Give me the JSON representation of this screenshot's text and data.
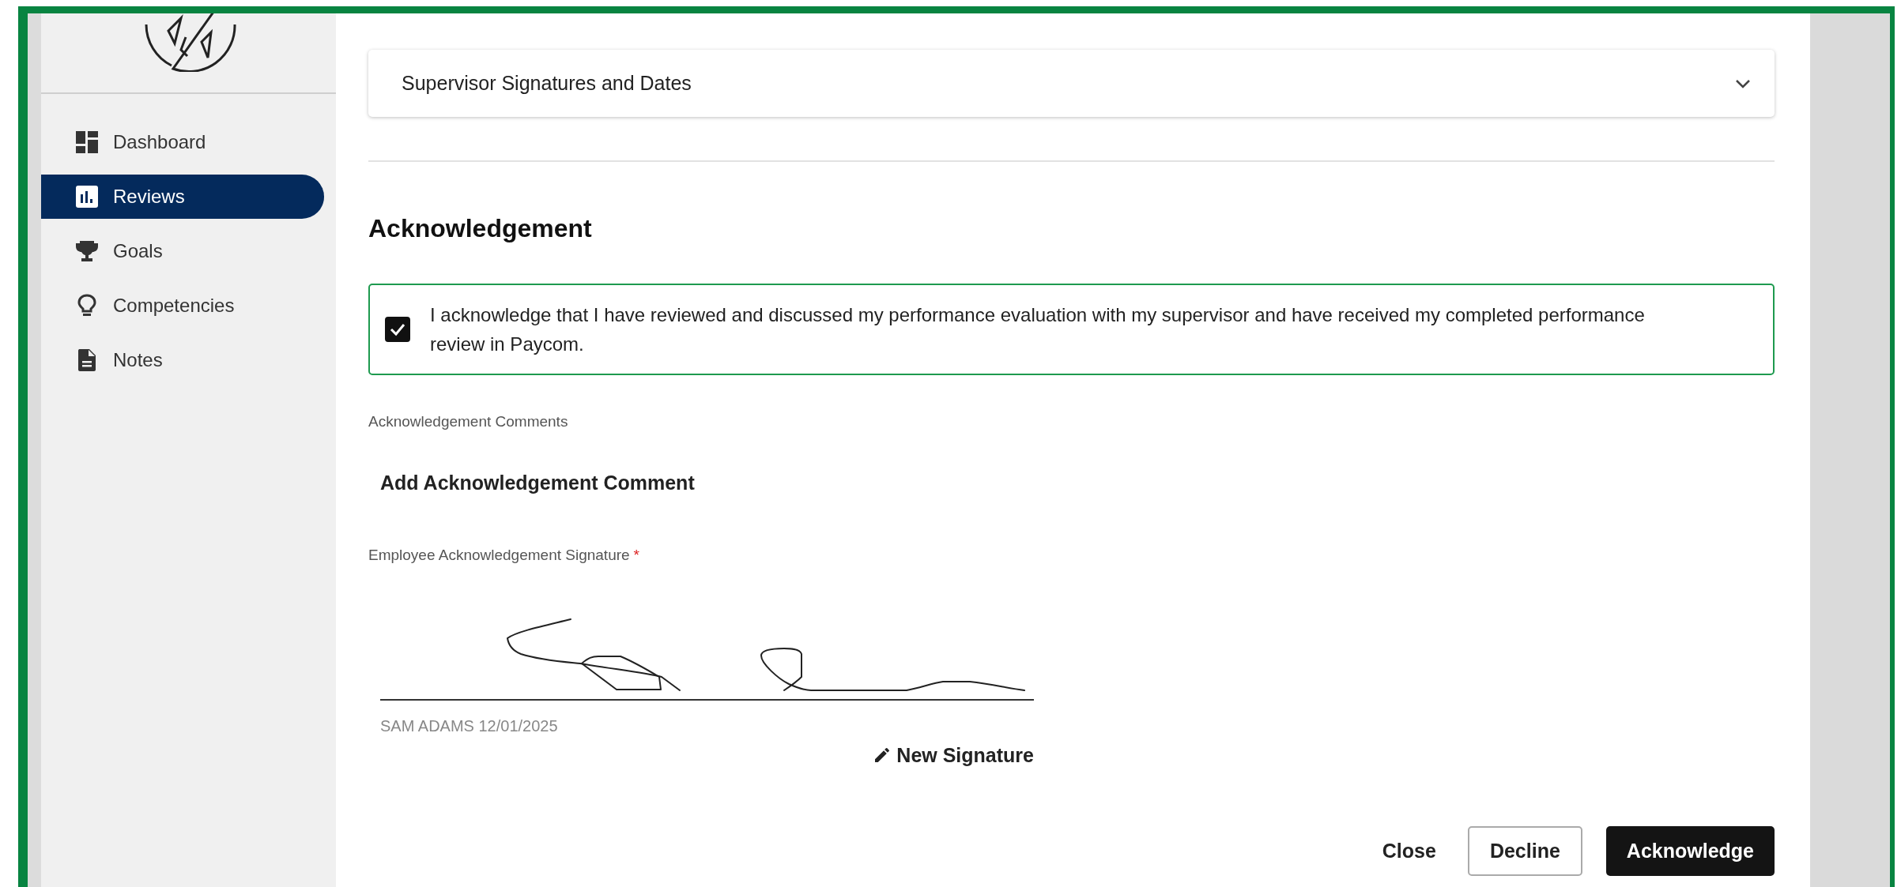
{
  "sidebar": {
    "items": [
      {
        "label": "Dashboard",
        "selected": false
      },
      {
        "label": "Reviews",
        "selected": true
      },
      {
        "label": "Goals",
        "selected": false
      },
      {
        "label": "Competencies",
        "selected": false
      },
      {
        "label": "Notes",
        "selected": false
      }
    ]
  },
  "accordion": {
    "title": "Supervisor Signatures and Dates",
    "expanded": false
  },
  "section_title": "Acknowledgement",
  "acknowledgement": {
    "checked": true,
    "text": "I acknowledge that I have reviewed and discussed my performance evaluation with my supervisor and have received my completed performance review in Paycom."
  },
  "comments": {
    "label": "Acknowledgement Comments",
    "add_button": "Add Acknowledgement Comment"
  },
  "signature": {
    "label": "Employee Acknowledgement Signature",
    "required_mark": "*",
    "signed_by": "SAM ADAMS 12/01/2025",
    "new_button": "New Signature"
  },
  "actions": [
    {
      "label": "Close",
      "kind": "text"
    },
    {
      "label": "Decline",
      "kind": "outlined"
    },
    {
      "label": "Acknowledge",
      "kind": "primary"
    }
  ]
}
